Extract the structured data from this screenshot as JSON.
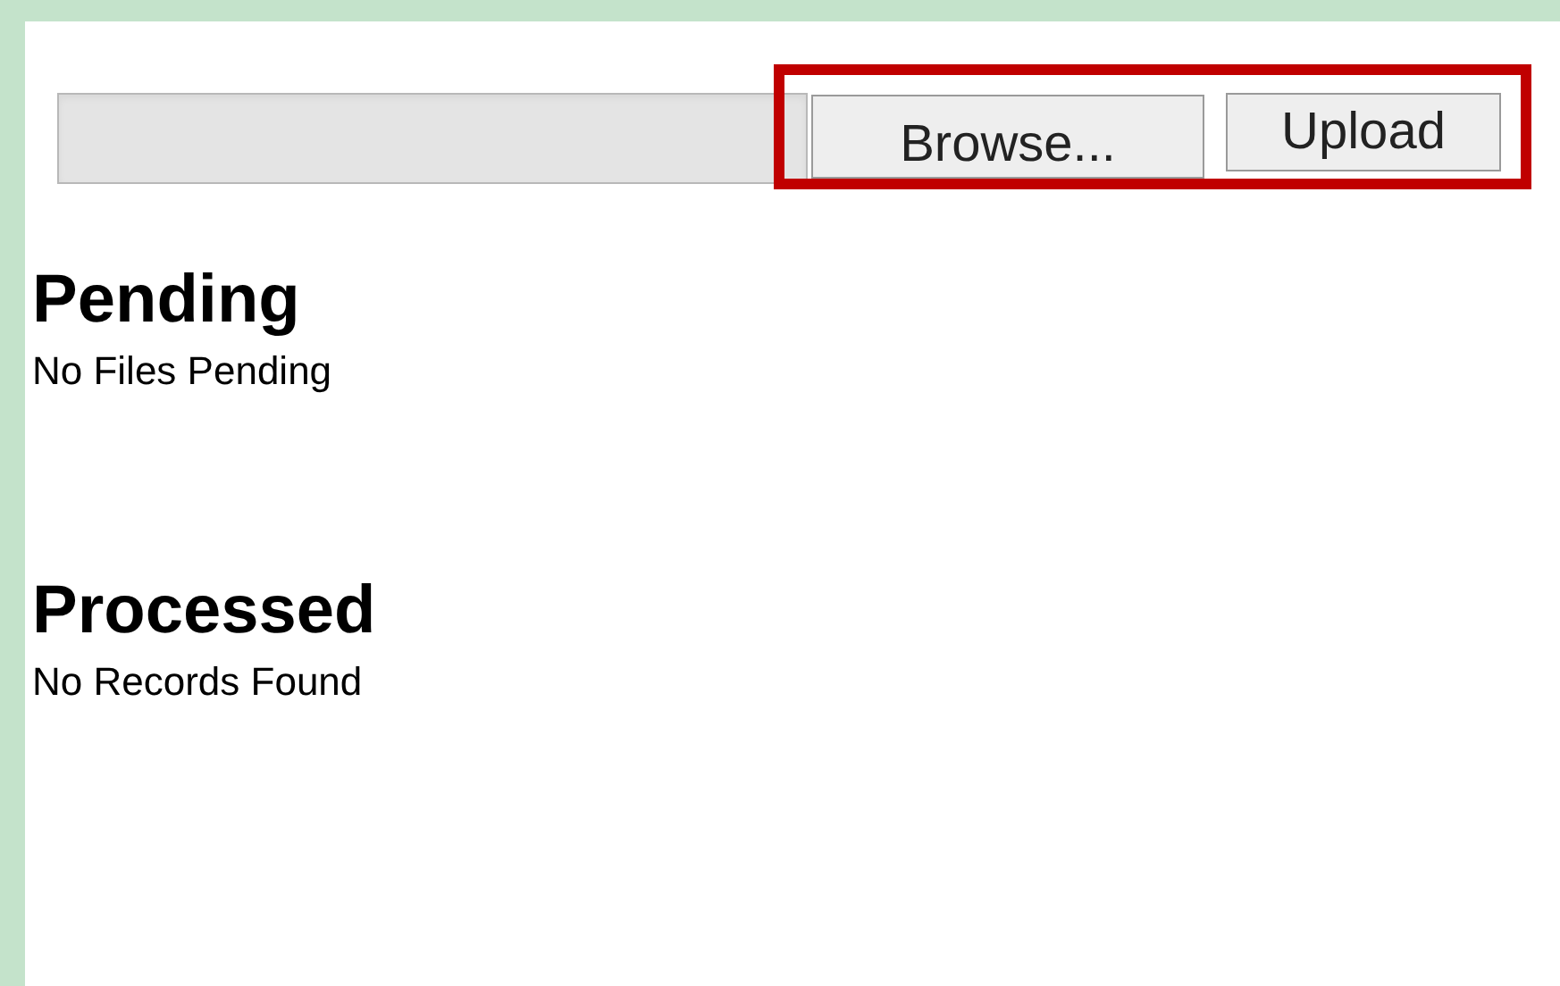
{
  "upload": {
    "browse_label": "Browse...",
    "upload_label": "Upload",
    "highlighted": true
  },
  "sections": [
    {
      "title": "Pending",
      "message": "No Files Pending"
    },
    {
      "title": "Processed",
      "message": "No Records Found"
    }
  ]
}
